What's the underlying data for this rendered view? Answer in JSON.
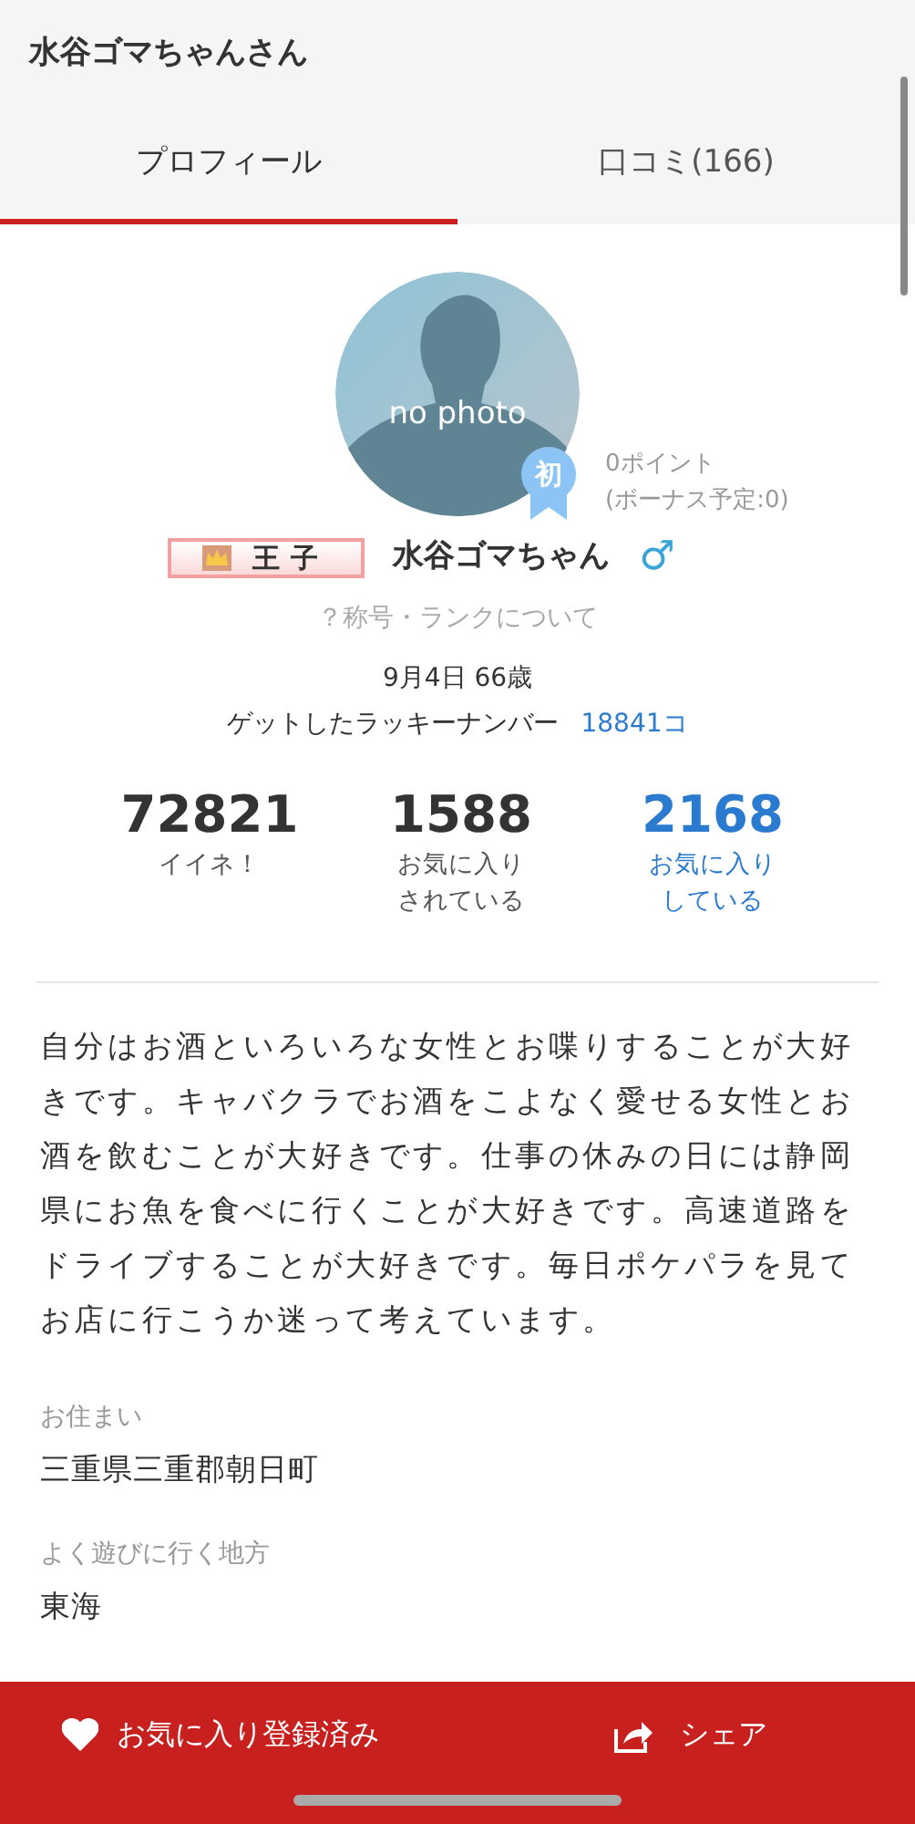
{
  "header": {
    "title": "水谷ゴマちゃんさん"
  },
  "tabs": [
    {
      "label": "プロフィール",
      "selected": true
    },
    {
      "label": "口コミ(166)",
      "selected": false
    }
  ],
  "profile": {
    "avatar_label": "no photo",
    "beginner_badge": "初",
    "points": "0ポイント",
    "bonus": "(ボーナス予定:0)",
    "rank": "王子",
    "name": "水谷ゴマちゃん",
    "sex": "♂",
    "rank_help": "？称号・ランクについて",
    "birthday_age": "9月4日 66歳",
    "lucky_label": "ゲットしたラッキーナンバー",
    "lucky_value": "18841コ"
  },
  "stats": [
    {
      "value": "72821",
      "label": "イイネ！",
      "link": false
    },
    {
      "value": "1588",
      "label": "お気に入りされている",
      "link": false
    },
    {
      "value": "2168",
      "label": "お気に入りしている",
      "link": true
    }
  ],
  "bio": "自分はお酒といろいろな女性とお喋りすることが大好きです。キャバクラでお酒をこよなく愛せる女性とお酒を飲むことが大好きです。仕事の休みの日には静岡県にお魚を食べに行くことが大好きです。高速道路をドライブすることが大好きです。毎日ポケパラを見てお店に行こうか迷って考えています。",
  "fields": [
    {
      "label": "お住まい",
      "value": "三重県三重郡朝日町"
    },
    {
      "label": "よく遊びに行く地方",
      "value": "東海"
    }
  ],
  "bottom_bar": {
    "favorite": {
      "label": "お気に入り登録済み",
      "on": true
    },
    "share": "シェア"
  }
}
